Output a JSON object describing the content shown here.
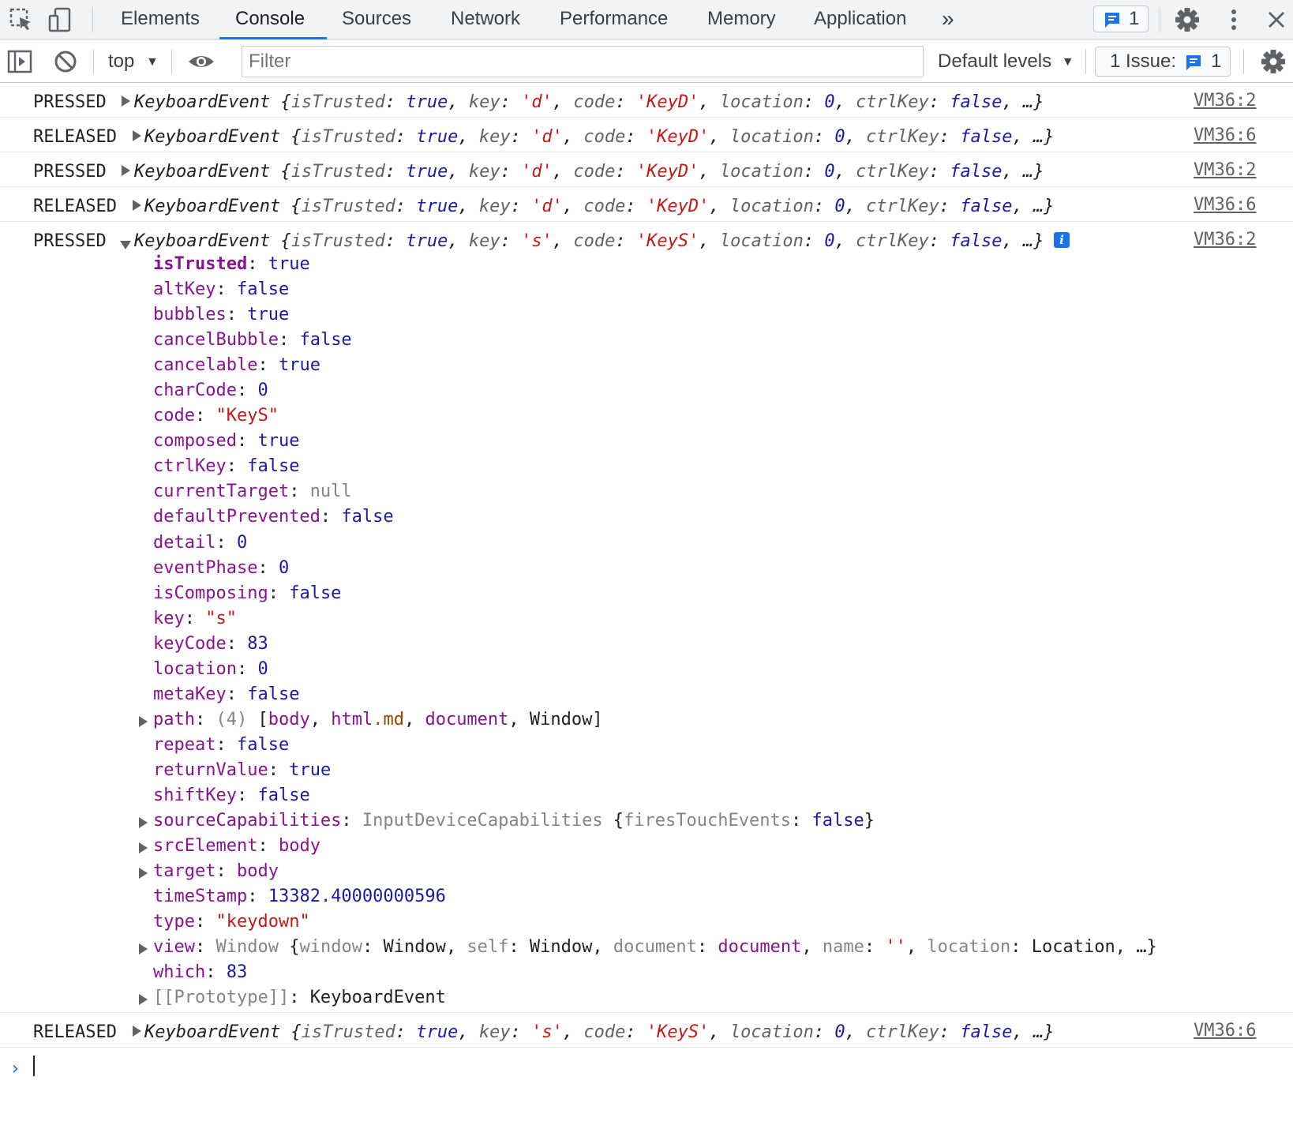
{
  "tabs": {
    "items": [
      {
        "label": "Elements"
      },
      {
        "label": "Console"
      },
      {
        "label": "Sources"
      },
      {
        "label": "Network"
      },
      {
        "label": "Performance"
      },
      {
        "label": "Memory"
      },
      {
        "label": "Application"
      }
    ],
    "active": "Console",
    "more": "»",
    "message_count": "1"
  },
  "toolbar": {
    "context": "top",
    "filter_placeholder": "Filter",
    "levels": "Default levels",
    "issues_label": "1 Issue:",
    "issues_count": "1"
  },
  "colors": {
    "accent": "#1a73e8",
    "property": "#881391",
    "boolean_number": "#1a1aa6",
    "string": "#c41a16"
  },
  "log": {
    "pressed": "PRESSED",
    "released": "RELEASED",
    "rows": [
      {
        "label": "PRESSED",
        "key": "'d'",
        "code": "'KeyD'",
        "src": "VM36:2"
      },
      {
        "label": "RELEASED",
        "key": "'d'",
        "code": "'KeyD'",
        "src": "VM36:6"
      },
      {
        "label": "PRESSED",
        "key": "'d'",
        "code": "'KeyD'",
        "src": "VM36:2"
      },
      {
        "label": "RELEASED",
        "key": "'d'",
        "code": "'KeyD'",
        "src": "VM36:6"
      },
      {
        "label": "PRESSED",
        "key": "'s'",
        "code": "'KeyS'",
        "src": "VM36:2"
      },
      {
        "label": "RELEASED",
        "key": "'s'",
        "code": "'KeyS'",
        "src": "VM36:6"
      }
    ],
    "summary": {
      "class": "KeyboardEvent",
      "open": "{",
      "isTrusted_k": "isTrusted",
      "isTrusted_v": "true",
      "key_k": "key",
      "code_k": "code",
      "location_k": "location",
      "location_v": "0",
      "ctrlKey_k": "ctrlKey",
      "ctrlKey_v": "false",
      "tail": ", …}"
    }
  },
  "expanded": {
    "props": [
      {
        "key": "isTrusted",
        "value": "true",
        "type": "b"
      },
      {
        "key": "altKey",
        "value": "false",
        "type": "b"
      },
      {
        "key": "bubbles",
        "value": "true",
        "type": "b"
      },
      {
        "key": "cancelBubble",
        "value": "false",
        "type": "b"
      },
      {
        "key": "cancelable",
        "value": "true",
        "type": "b"
      },
      {
        "key": "charCode",
        "value": "0",
        "type": "n"
      },
      {
        "key": "code",
        "value": "\"KeyS\"",
        "type": "s"
      },
      {
        "key": "composed",
        "value": "true",
        "type": "b"
      },
      {
        "key": "ctrlKey",
        "value": "false",
        "type": "b"
      },
      {
        "key": "currentTarget",
        "value": "null",
        "type": "g"
      },
      {
        "key": "defaultPrevented",
        "value": "false",
        "type": "b"
      },
      {
        "key": "detail",
        "value": "0",
        "type": "n"
      },
      {
        "key": "eventPhase",
        "value": "0",
        "type": "n"
      },
      {
        "key": "isComposing",
        "value": "false",
        "type": "b"
      },
      {
        "key": "key",
        "value": "\"s\"",
        "type": "s"
      },
      {
        "key": "keyCode",
        "value": "83",
        "type": "n"
      },
      {
        "key": "location",
        "value": "0",
        "type": "n"
      },
      {
        "key": "metaKey",
        "value": "false",
        "type": "b"
      }
    ],
    "path": {
      "key": "path",
      "count": "(4)",
      "body": "body",
      "html": "html",
      "md": ".md",
      "document": "document",
      "window": "Window"
    },
    "props2": [
      {
        "key": "repeat",
        "value": "false",
        "type": "b"
      },
      {
        "key": "returnValue",
        "value": "true",
        "type": "b"
      },
      {
        "key": "shiftKey",
        "value": "false",
        "type": "b"
      }
    ],
    "sourceCapabilities": {
      "key": "sourceCapabilities",
      "cls": "InputDeviceCapabilities",
      "inner_k": "firesTouchEvents",
      "inner_v": "false"
    },
    "srcElement": {
      "key": "srcElement",
      "value": "body"
    },
    "target": {
      "key": "target",
      "value": "body"
    },
    "timeStamp": {
      "key": "timeStamp",
      "value": "13382.40000000596"
    },
    "type": {
      "key": "type",
      "value": "\"keydown\""
    },
    "view": {
      "key": "view",
      "cls": "Window",
      "window_k": "window",
      "window_v": "Window",
      "self_k": "self",
      "self_v": "Window",
      "document_k": "document",
      "document_v": "document",
      "name_k": "name",
      "name_v": "''",
      "location_k": "location",
      "location_v": "Location",
      "tail": ", …}"
    },
    "which": {
      "key": "which",
      "value": "83"
    },
    "prototype": {
      "key": "[[Prototype]]",
      "value": "KeyboardEvent"
    }
  },
  "prompt": "›"
}
